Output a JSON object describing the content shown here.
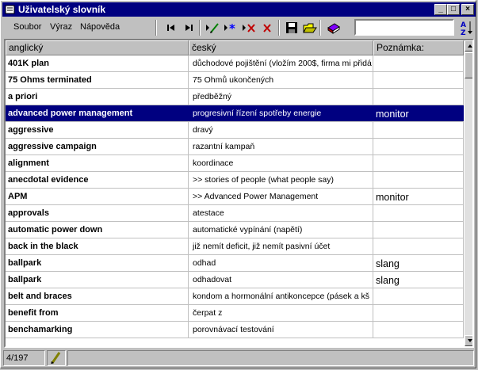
{
  "window": {
    "title": "Uživatelský slovník",
    "title_color": "#000080"
  },
  "menu": [
    {
      "label": "Soubor"
    },
    {
      "label": "Výraz"
    },
    {
      "label": "Nápověda"
    }
  ],
  "toolbar": {
    "buttons": [
      "first-record-icon",
      "last-record-icon",
      "edit-record-icon",
      "new-record-icon",
      "delete-edit-icon",
      "delete-record-icon",
      "save-icon",
      "open-folder-icon",
      "dictionary-book-icon"
    ],
    "search_value": "",
    "sort_icon": "sort-az-icon"
  },
  "table": {
    "headers": [
      "anglický",
      "český",
      "Poznámka:"
    ],
    "selected_row": 3,
    "rows": [
      [
        "401K plan",
        "důchodové pojištění (vložím 200$, firma mi přidá",
        ""
      ],
      [
        "75 Ohms terminated",
        "75 Ohmů ukončených",
        ""
      ],
      [
        "a priori",
        "předběžný",
        ""
      ],
      [
        "advanced power management",
        "progresivní řízení spotřeby energie",
        "monitor"
      ],
      [
        "aggressive",
        "dravý",
        ""
      ],
      [
        "aggressive campaign",
        "razantní kampaň",
        ""
      ],
      [
        "alignment",
        "koordinace",
        ""
      ],
      [
        "anecdotal evidence",
        ">> stories of people (what people say)",
        ""
      ],
      [
        "APM",
        ">> Advanced Power Management",
        "monitor"
      ],
      [
        "approvals",
        "atestace",
        ""
      ],
      [
        "automatic power down",
        "automatické vypínání (napětí)",
        ""
      ],
      [
        "back in the black",
        "již nemít deficit, již nemít pasivní účet",
        ""
      ],
      [
        "ballpark",
        "odhad",
        "slang"
      ],
      [
        "ballpark",
        "odhadovat",
        "slang"
      ],
      [
        "belt and braces",
        "kondom a hormonální antikoncepce (pásek a kš",
        ""
      ],
      [
        "benefit from",
        "čerpat z",
        ""
      ],
      [
        "benchamarking",
        "porovnávací testování",
        ""
      ]
    ]
  },
  "status": {
    "position": "4/197",
    "icon": "pencil-icon"
  }
}
